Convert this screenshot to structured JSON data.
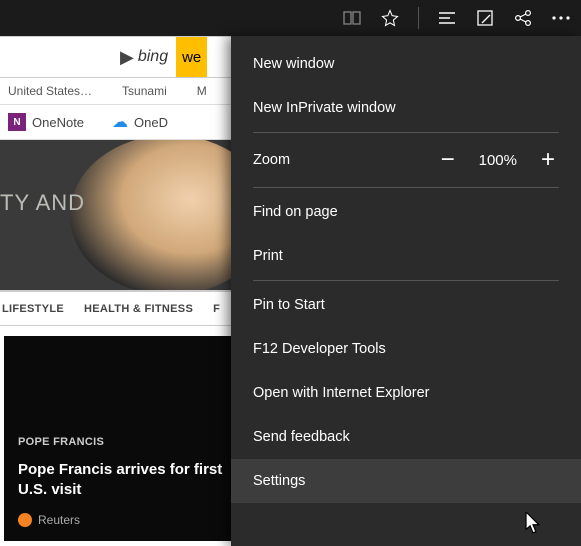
{
  "titlebar": {
    "icons": [
      "reading-list",
      "favorite",
      "hub",
      "note",
      "share",
      "more"
    ]
  },
  "search": {
    "engine": "bing",
    "partial": "we"
  },
  "trending": [
    "United States…",
    "Tsunami",
    "M"
  ],
  "apps": {
    "onenote": "OneNote",
    "onedrive": "OneD"
  },
  "hero": {
    "text": "TY AND"
  },
  "nav": {
    "a": "LIFESTYLE",
    "b": "HEALTH & FITNESS",
    "c": "F"
  },
  "tile": {
    "category": "POPE FRANCIS",
    "headline": "Pope Francis arrives for first U.S. visit",
    "source": "Reuters"
  },
  "menu": {
    "new_window": "New window",
    "new_inprivate": "New InPrivate window",
    "zoom_label": "Zoom",
    "zoom_value": "100%",
    "find": "Find on page",
    "print": "Print",
    "pin": "Pin to Start",
    "devtools": "F12 Developer Tools",
    "open_ie": "Open with Internet Explorer",
    "feedback": "Send feedback",
    "settings": "Settings"
  }
}
